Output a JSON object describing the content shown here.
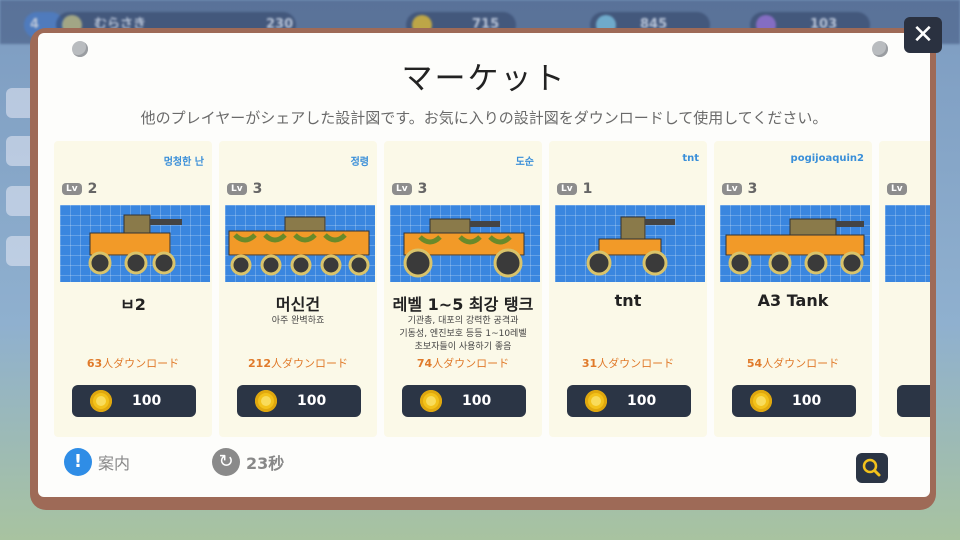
{
  "background": {
    "level": "4",
    "player_name": "むらさき",
    "trophies": "230",
    "coins": "715",
    "gems": "845",
    "tickets": "103"
  },
  "market": {
    "title": "マーケット",
    "subtitle": "他のプレイヤーがシェアした設計図です。お気に入りの設計図をダウンロードして使用してください。",
    "close_label": "✕",
    "help_label": "案内",
    "help_icon_glyph": "!",
    "timer_label": "23秒",
    "refresh_icon_glyph": "↻",
    "accent_color": "#2f8de6",
    "download_color": "#e07a2a"
  },
  "cards": [
    {
      "author": "멍청한 난",
      "level_badge": "Lv",
      "level": "2",
      "name": "ㅂ2",
      "desc": "",
      "download_count": "63",
      "download_suffix": "人ダウンロード",
      "price": "100"
    },
    {
      "author": "정령",
      "level_badge": "Lv",
      "level": "3",
      "name": "머신건",
      "desc": "아주 완벽하죠",
      "download_count": "212",
      "download_suffix": "人ダウンロード",
      "price": "100"
    },
    {
      "author": "도순",
      "level_badge": "Lv",
      "level": "3",
      "name": "레벨 1~5 최강 탱크",
      "desc": "기관총, 대포의 강력한 공격과\n기동성, 엔진보호 등등 1~10레벨\n초보자들이 사용하기 좋음",
      "download_count": "74",
      "download_suffix": "人ダウンロード",
      "price": "100"
    },
    {
      "author": "tnt",
      "level_badge": "Lv",
      "level": "1",
      "name": "tnt",
      "desc": "",
      "download_count": "31",
      "download_suffix": "人ダウンロード",
      "price": "100"
    },
    {
      "author": "pogijoaquin2",
      "level_badge": "Lv",
      "level": "3",
      "name": "A3 Tank",
      "desc": "",
      "download_count": "54",
      "download_suffix": "人ダウンロード",
      "price": "100"
    },
    {
      "author": "",
      "level_badge": "Lv",
      "level": "",
      "name": "",
      "desc": "",
      "download_count": "",
      "download_suffix": "",
      "price": ""
    }
  ]
}
